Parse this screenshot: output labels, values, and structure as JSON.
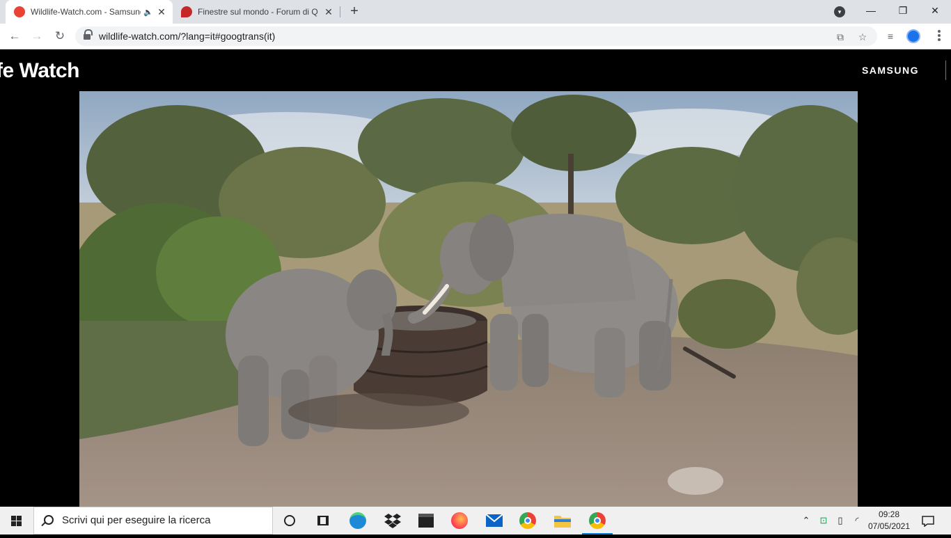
{
  "browser": {
    "tabs": [
      {
        "title": "Wildlife-Watch.com - Samsung",
        "favicon_color": "#ea4335",
        "audio": "audio-playing",
        "active": true
      },
      {
        "title": "Finestre sul mondo - Forum di Q",
        "favicon_color": "#c62828",
        "active": false
      }
    ],
    "new_tab_label": "+",
    "url": "wildlife-watch.com/?lang=it#googtrans(it)",
    "window_controls": {
      "minimize": "—",
      "maximize": "❐",
      "close": "✕"
    }
  },
  "site": {
    "logo_text": "fe Watch",
    "brand": "SAMSUNG"
  },
  "video": {
    "scene": "livestream-waterhole-elephants"
  },
  "taskbar": {
    "search_placeholder": "Scrivi qui per eseguire la ricerca",
    "time": "09:28",
    "date": "07/05/2021",
    "pinned_apps": [
      "cortana-icon",
      "task-view-icon",
      "edge-icon",
      "dropbox-icon",
      "store-icon",
      "firefox-icon",
      "mail-icon",
      "chrome-icon",
      "file-explorer-icon",
      "chrome-active-icon"
    ]
  },
  "colors": {
    "tabstrip": "#dee1e6",
    "toolbar": "#ffffff",
    "page_bg": "#000000",
    "taskbar": "#f0f0f0",
    "accent": "#0078d7"
  }
}
